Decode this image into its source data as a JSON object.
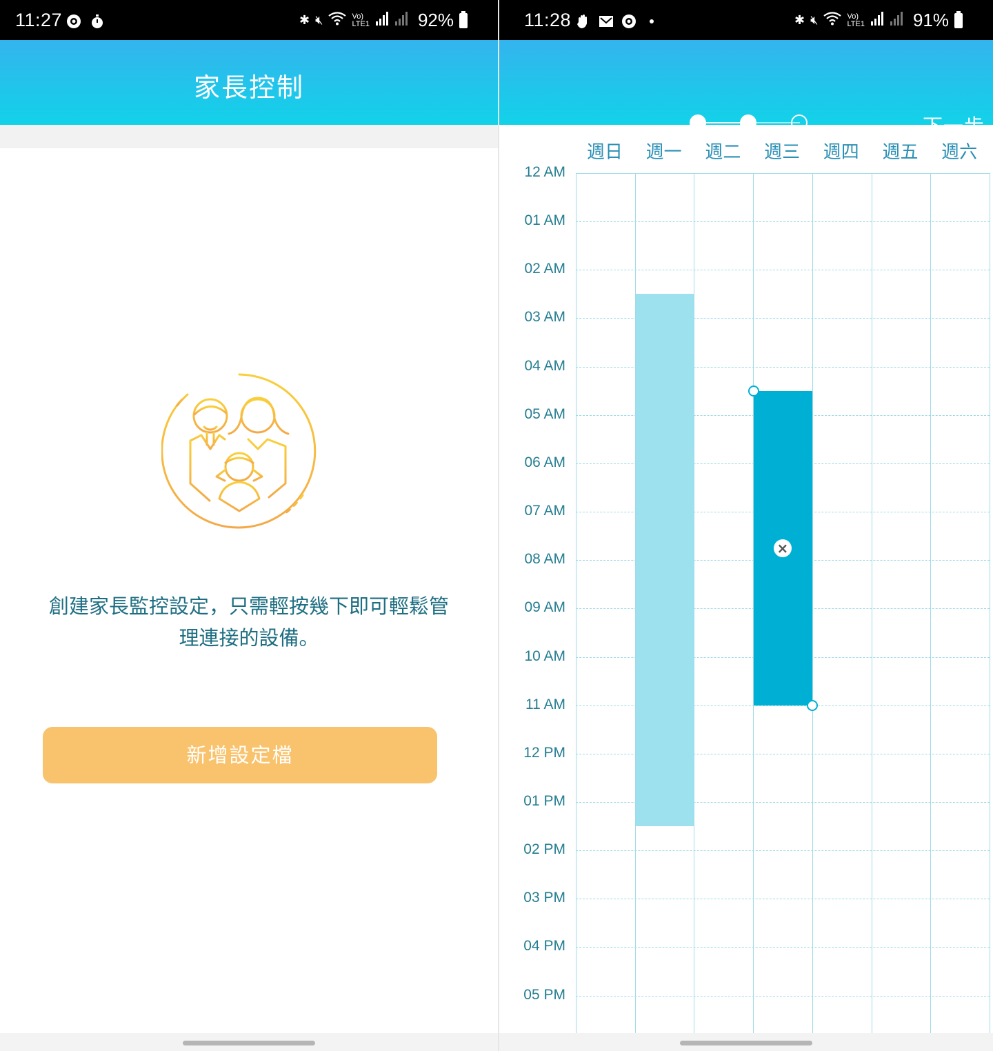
{
  "left_screen": {
    "status": {
      "time": "11:27",
      "battery": "92%"
    },
    "header": {
      "title": "家長控制"
    },
    "description_line1": "創建家長監控設定，只需輕按幾下即可輕鬆管",
    "description_line2": "理連接的設備。",
    "add_button_label": "新增設定檔",
    "illustration_icon": "family-icon",
    "colors": {
      "accent": "#f9c36d",
      "text": "#1e6e82",
      "header_top": "#34b4ee",
      "header_bottom": "#12d2e8"
    }
  },
  "right_screen": {
    "status": {
      "time": "11:28",
      "battery": "91%"
    },
    "stepper": {
      "current_step": 2,
      "total_steps": 3
    },
    "next_label": "下一步",
    "days": [
      "週日",
      "週一",
      "週二",
      "週三",
      "週四",
      "週五",
      "週六"
    ],
    "time_labels": [
      "12 AM",
      "01 AM",
      "02 AM",
      "03 AM",
      "04 AM",
      "05 AM",
      "06 AM",
      "07 AM",
      "08 AM",
      "09 AM",
      "10 AM",
      "11 AM",
      "12 PM",
      "01 PM",
      "02 PM",
      "03 PM",
      "04 PM",
      "05 PM"
    ],
    "schedule_blocks": [
      {
        "day": "週一",
        "start_hour": 2.5,
        "end_hour": 13.5,
        "state": "saved",
        "color": "#9de1ee"
      },
      {
        "day": "週三",
        "start_hour": 4.5,
        "end_hour": 11.0,
        "state": "editing",
        "color": "#00b0d4"
      }
    ],
    "delete_icon": "close-icon",
    "colors": {
      "day_text": "#2a8fb4",
      "grid": "#9fdbe6",
      "time_text": "#247d92"
    }
  }
}
